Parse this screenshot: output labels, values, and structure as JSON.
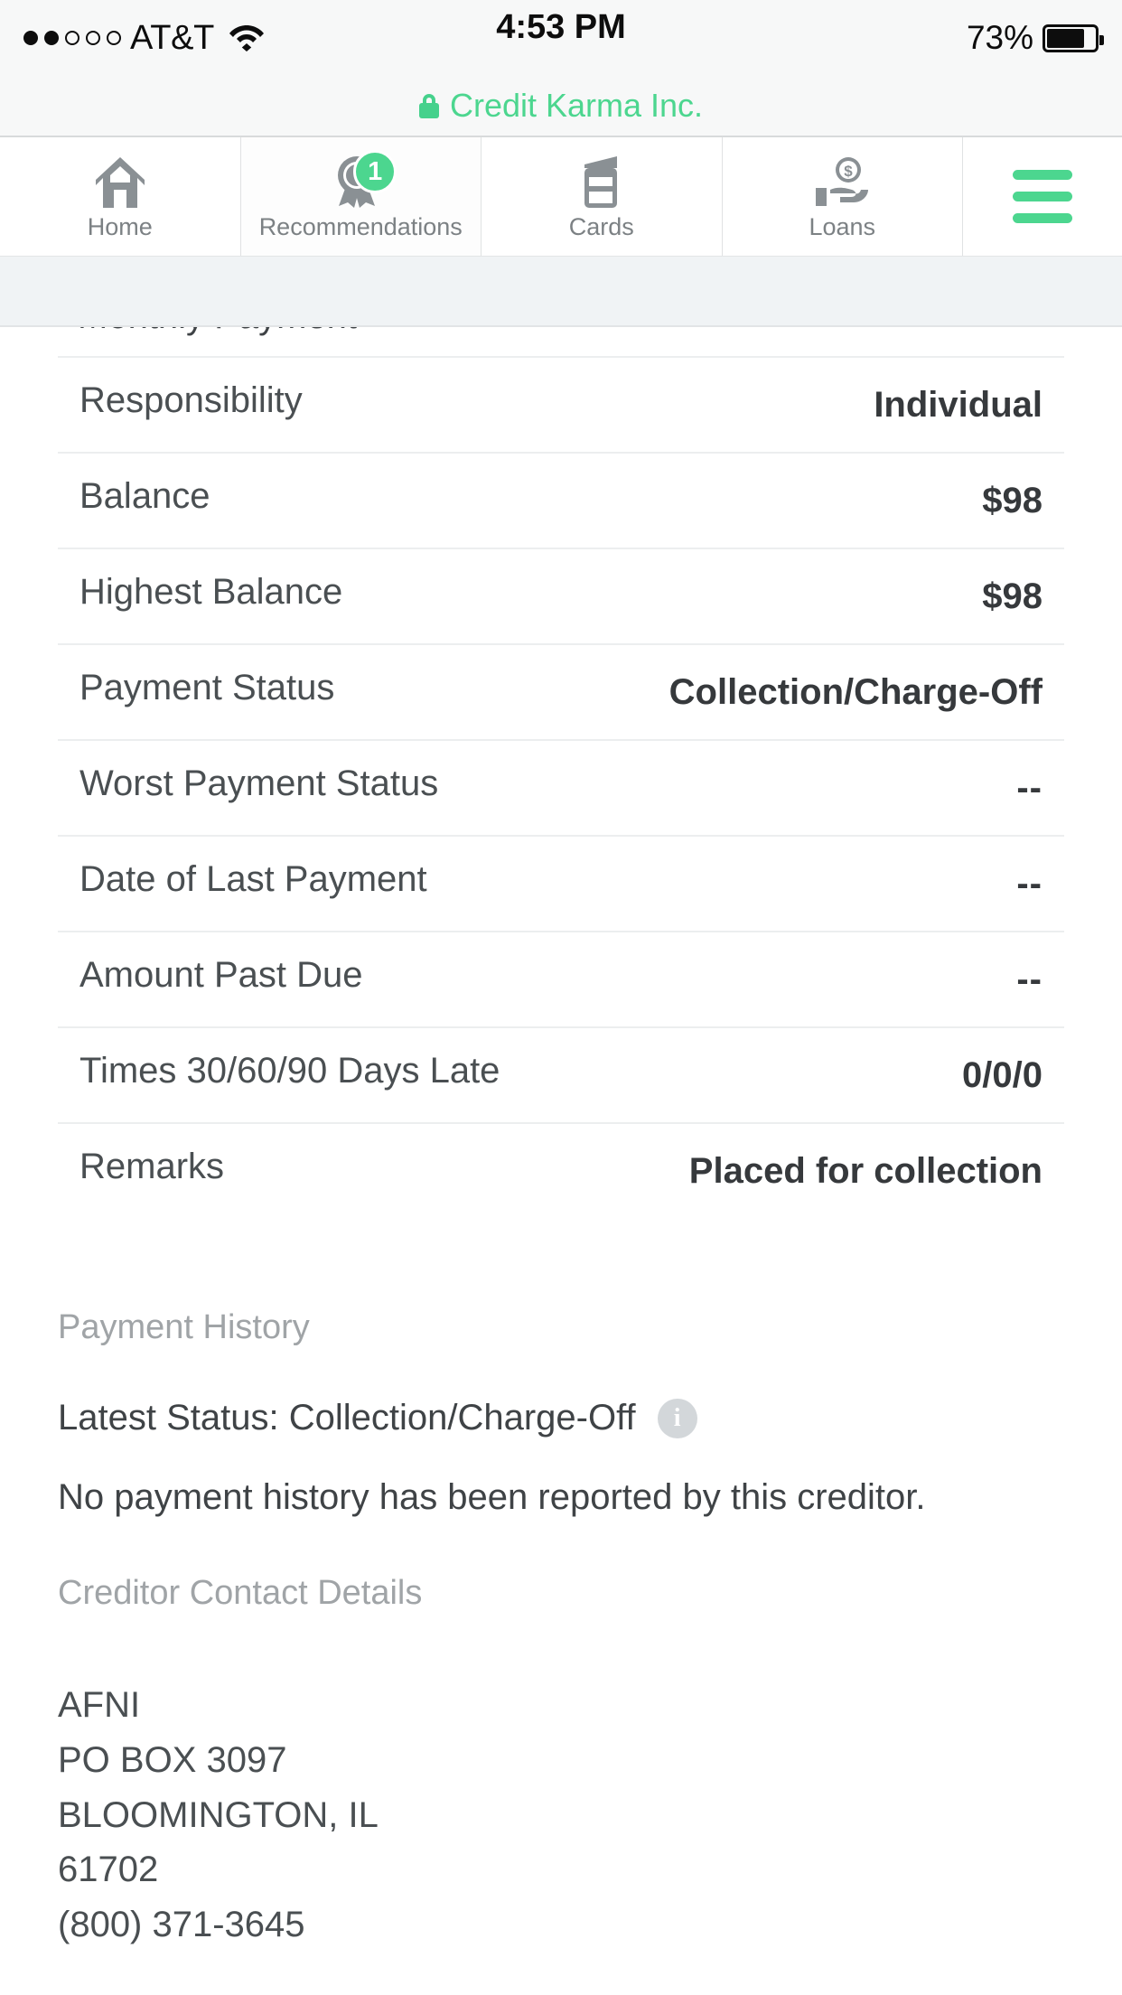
{
  "status_bar": {
    "carrier": "AT&T",
    "signal_dots_filled": 2,
    "signal_dots_total": 5,
    "wifi_icon": "wifi-icon",
    "time": "4:53 PM",
    "battery_percent": "73%",
    "battery_level": 73
  },
  "site_bar": {
    "lock_icon": "lock-icon",
    "site_name": "Credit Karma Inc.",
    "accent_color": "#4cd68f"
  },
  "nav": {
    "tabs": [
      {
        "label": "Home",
        "icon": "home-icon",
        "badge": null
      },
      {
        "label": "Recommendations",
        "icon": "ribbon-award-icon",
        "badge": "1"
      },
      {
        "label": "Cards",
        "icon": "credit-card-icon",
        "badge": null
      },
      {
        "label": "Loans",
        "icon": "hand-dollar-icon",
        "badge": null
      }
    ],
    "menu_icon": "hamburger-menu-icon"
  },
  "account_details": {
    "clipped_row_label": "Monthly Payment",
    "rows": [
      {
        "label": "Responsibility",
        "value": "Individual"
      },
      {
        "label": "Balance",
        "value": "$98"
      },
      {
        "label": "Highest Balance",
        "value": "$98"
      },
      {
        "label": "Payment Status",
        "value": "Collection/Charge-Off"
      },
      {
        "label": "Worst Payment Status",
        "value": "--"
      },
      {
        "label": "Date of Last Payment",
        "value": "--"
      },
      {
        "label": "Amount Past Due",
        "value": "--"
      },
      {
        "label": "Times 30/60/90 Days Late",
        "value": "0/0/0"
      },
      {
        "label": "Remarks",
        "value": "Placed for collection"
      }
    ]
  },
  "payment_history": {
    "title": "Payment History",
    "latest_status": "Latest Status: Collection/Charge-Off",
    "info_icon": "info-icon",
    "empty_message": "No payment history has been reported by this creditor."
  },
  "creditor_contact": {
    "title": "Creditor Contact Details",
    "name": "AFNI",
    "street": "PO BOX 3097",
    "city_state": "BLOOMINGTON, IL",
    "zip": "61702",
    "phone": "(800) 371-3645"
  }
}
